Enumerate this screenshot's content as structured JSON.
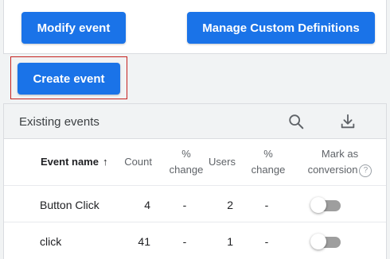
{
  "buttons": {
    "modify": "Modify event",
    "manage": "Manage Custom Definitions",
    "create": "Create event"
  },
  "table": {
    "title": "Existing events",
    "search_icon": "search-icon",
    "download_icon": "download-icon",
    "columns": {
      "event_name": "Event name",
      "sort_indicator": "↑",
      "count": "Count",
      "pct_change_1": [
        "%",
        "change"
      ],
      "users": "Users",
      "pct_change_2": [
        "%",
        "change"
      ],
      "mark_conversion": [
        "Mark as",
        "conversion"
      ],
      "help": "?"
    },
    "rows": [
      {
        "name": "Button Click",
        "count": "4",
        "pct_change_count": "-",
        "users": "2",
        "pct_change_users": "-",
        "conversion": false
      },
      {
        "name": "click",
        "count": "41",
        "pct_change_count": "-",
        "users": "1",
        "pct_change_users": "-",
        "conversion": false
      }
    ]
  },
  "colors": {
    "primary": "#1a73e8",
    "highlight_border": "#c5221f",
    "toggle_off": "#9e9e9e"
  }
}
